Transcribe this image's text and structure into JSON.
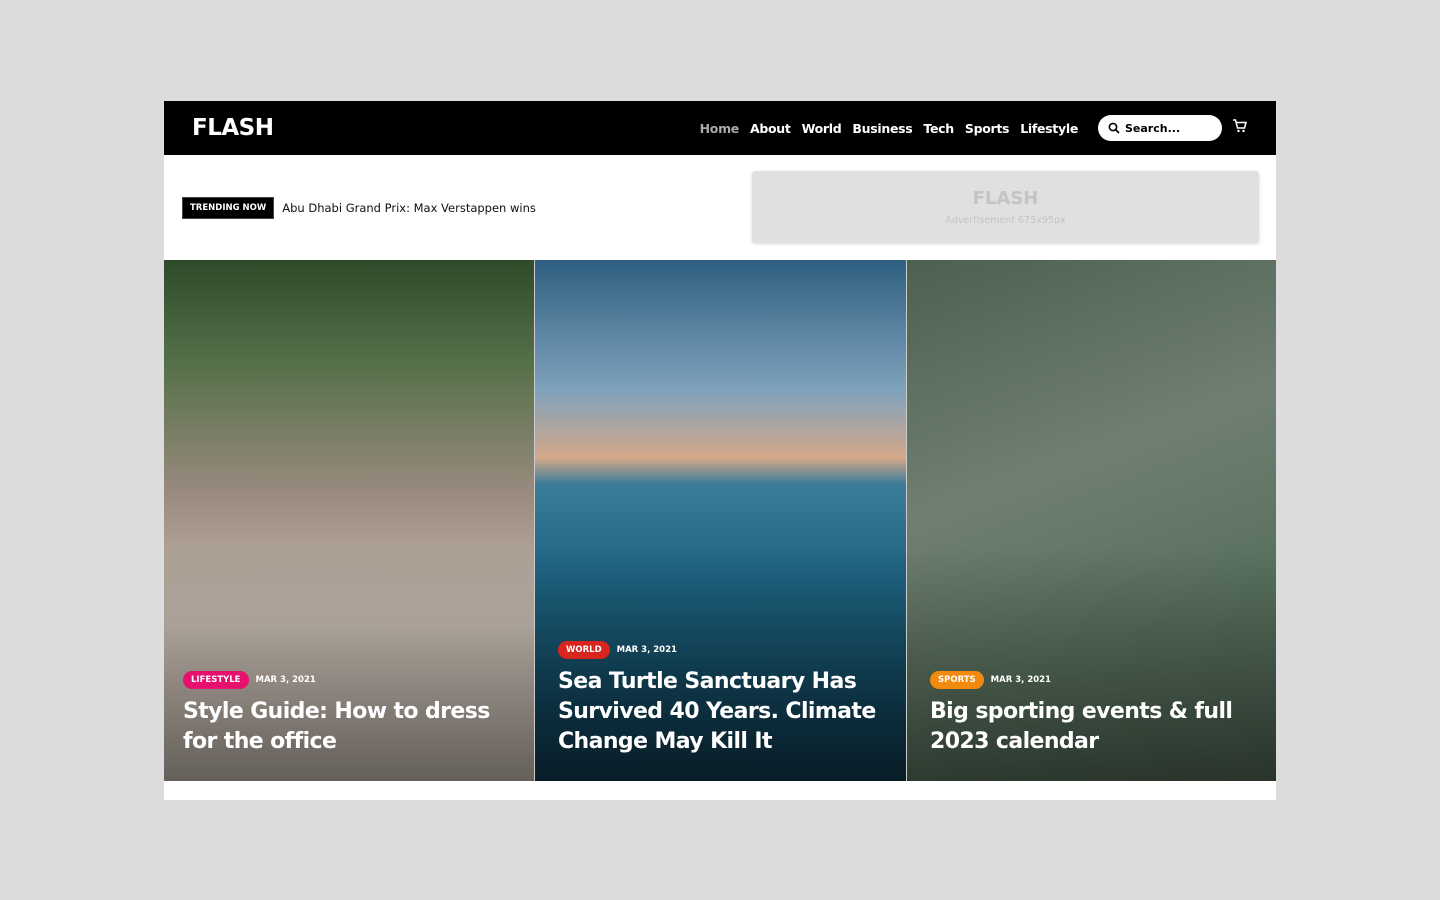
{
  "header": {
    "logo": "FLASH",
    "nav": [
      "Home",
      "About",
      "World",
      "Business",
      "Tech",
      "Sports",
      "Lifestyle"
    ],
    "active": "Home",
    "search_placeholder": "Search...",
    "icons": [
      "search-icon",
      "cart-icon"
    ]
  },
  "trending": {
    "label": "TRENDING NOW",
    "text": "Abu Dhabi Grand Prix: Max Verstappen wins"
  },
  "ad": {
    "logo": "FLASH",
    "text": "Advertisement 675x95px"
  },
  "cards": [
    {
      "category": "LIFESTYLE",
      "color": "#e8106e",
      "date": "MAR 3, 2021",
      "title": "Style Guide: How to dress for the office"
    },
    {
      "category": "WORLD",
      "color": "#d8261f",
      "date": "MAR 3, 2021",
      "title": "Sea Turtle Sanctuary Has Survived 40 Years. Climate Change May Kill It"
    },
    {
      "category": "SPORTS",
      "color": "#f28a0f",
      "date": "MAR 3, 2021",
      "title": "Big sporting events & full 2023 calendar"
    }
  ]
}
